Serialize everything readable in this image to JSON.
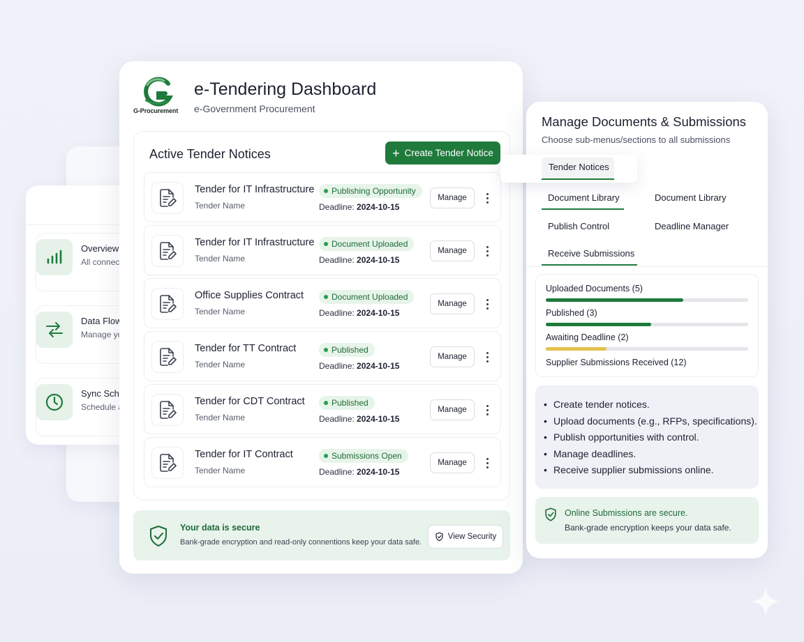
{
  "brand": {
    "logo_text": "G-Procurement",
    "accent_color": "#1f7a3c"
  },
  "header": {
    "title": "e-Tendering Dashboard",
    "subtitle": "e-Government Procurement"
  },
  "side_panel": {
    "items": [
      {
        "title": "Overview",
        "subtitle": "All connect",
        "icon": "bar-chart-icon"
      },
      {
        "title": "Data Flow",
        "subtitle": "Manage yo",
        "icon": "arrows-exchange-icon"
      },
      {
        "title": "Sync Sche",
        "subtitle": "Schedule a",
        "icon": "clock-icon"
      }
    ]
  },
  "tenders": {
    "title": "Active Tender Notices",
    "create_label": "Create Tender Notice",
    "deadline_prefix": "Deadline:",
    "manage_label": "Manage",
    "rows": [
      {
        "name": "Tender for IT Infrastructure",
        "sub": "Tender Name",
        "status": "Publishing Opportunity",
        "deadline": "2024-10-15"
      },
      {
        "name": "Tender for IT Infrastructure",
        "sub": "Tender Name",
        "status": "Document Uploaded",
        "deadline": "2024-10-15"
      },
      {
        "name": "Office Supplies Contract",
        "sub": "Tender Name",
        "status": "Document Uploaded",
        "deadline": "2024-10-15"
      },
      {
        "name": "Tender for TT Contract",
        "sub": "Tender Name",
        "status": "Published",
        "deadline": "2024-10-15"
      },
      {
        "name": "Tender for CDT Contract",
        "sub": "Tender Name",
        "status": "Published",
        "deadline": "2024-10-15"
      },
      {
        "name": "Tender for IT Contract",
        "sub": "Tender Name",
        "status": "Submissions Open",
        "deadline": "2024-10-15"
      }
    ]
  },
  "security": {
    "title": "Your data is secure",
    "text": "Bank-grade encryption and read-only connentions keep your data safe.",
    "button": "View Security"
  },
  "manage_panel": {
    "title": "Manage Documents & Submissions",
    "subtitle": "Choose sub-menus/sections to  all submissions",
    "tabs": {
      "tender_notices": "Tender Notices",
      "document_library": "Document Library",
      "document_library_2": "Document Library",
      "publish_control": "Publish Control",
      "deadline_manager": "Deadline Manager",
      "receive_submissions": "Receive Submissions"
    },
    "stats": [
      {
        "label": "Uploaded Documents (5)",
        "progress": 0.68,
        "color": "#1f7a3c"
      },
      {
        "label": "Published (3)",
        "progress": 0.52,
        "color": "#1f7a3c"
      },
      {
        "label": "Awaiting Deadline (2)",
        "progress": 0.3,
        "color": "#e5c14a"
      },
      {
        "label": "Supplier Submissions Received (12)",
        "progress": null,
        "color": null
      }
    ],
    "features": [
      "Create tender notices.",
      "Upload documents (e.g., RFPs, specifications).",
      "Publish opportunities with control.",
      "Manage deadlines.",
      "Receive supplier submissions online."
    ],
    "secure_title": "Online Submissions are secure.",
    "secure_text": "Bank-grade encryption keeps your data safe."
  }
}
